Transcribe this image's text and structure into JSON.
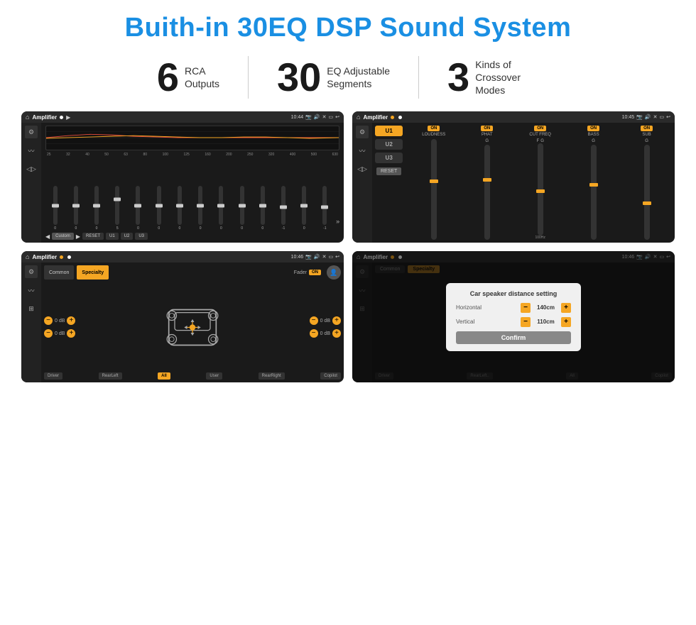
{
  "page": {
    "title": "Buith-in 30EQ DSP Sound System",
    "stats": [
      {
        "number": "6",
        "label": "RCA\nOutputs"
      },
      {
        "number": "30",
        "label": "EQ Adjustable\nSegments"
      },
      {
        "number": "3",
        "label": "Kinds of\nCrossover Modes"
      }
    ],
    "screens": [
      {
        "id": "screen1",
        "statusBar": {
          "title": "Amplifier",
          "time": "10:44",
          "icons": [
            "home",
            "play",
            "pause"
          ]
        },
        "type": "eq",
        "freqs": [
          "25",
          "32",
          "40",
          "50",
          "63",
          "80",
          "100",
          "125",
          "160",
          "200",
          "250",
          "320",
          "400",
          "500",
          "630"
        ],
        "sliderValues": [
          "0",
          "0",
          "0",
          "5",
          "0",
          "0",
          "0",
          "0",
          "0",
          "0",
          "0",
          "-1",
          "0",
          "-1"
        ],
        "presetLabel": "Custom",
        "presets": [
          "RESET",
          "U1",
          "U2",
          "U3"
        ]
      },
      {
        "id": "screen2",
        "statusBar": {
          "title": "Amplifier",
          "time": "10:45"
        },
        "type": "amp",
        "uButtons": [
          "U1",
          "U2",
          "U3"
        ],
        "controls": [
          {
            "label": "LOUDNESS",
            "on": true
          },
          {
            "label": "PHAT",
            "on": true
          },
          {
            "label": "CUT FREQ",
            "on": true
          },
          {
            "label": "BASS",
            "on": true
          },
          {
            "label": "SUB",
            "on": true
          }
        ],
        "resetLabel": "RESET"
      },
      {
        "id": "screen3",
        "statusBar": {
          "title": "Amplifier",
          "time": "10:46"
        },
        "type": "fader",
        "tabs": [
          "Common",
          "Specialty"
        ],
        "activeTab": "Specialty",
        "faderLabel": "Fader",
        "faderOn": "ON",
        "volumeRows": [
          {
            "value": "0 dB"
          },
          {
            "value": "0 dB"
          },
          {
            "value": "0 dB"
          },
          {
            "value": "0 dB"
          }
        ],
        "bottomButtons": [
          "Driver",
          "RearLeft",
          "All",
          "User",
          "RearRight",
          "Copilot"
        ]
      },
      {
        "id": "screen4",
        "statusBar": {
          "title": "Amplifier",
          "time": "10:46"
        },
        "type": "dialog",
        "tabs": [
          "Common",
          "Specialty"
        ],
        "dialog": {
          "title": "Car speaker distance setting",
          "fields": [
            {
              "label": "Horizontal",
              "value": "140cm"
            },
            {
              "label": "Vertical",
              "value": "110cm"
            }
          ],
          "confirmLabel": "Confirm"
        },
        "bottomButtons": [
          "Driver",
          "RearLeft",
          "All",
          "User",
          "RearRight",
          "Copilot"
        ]
      }
    ]
  }
}
